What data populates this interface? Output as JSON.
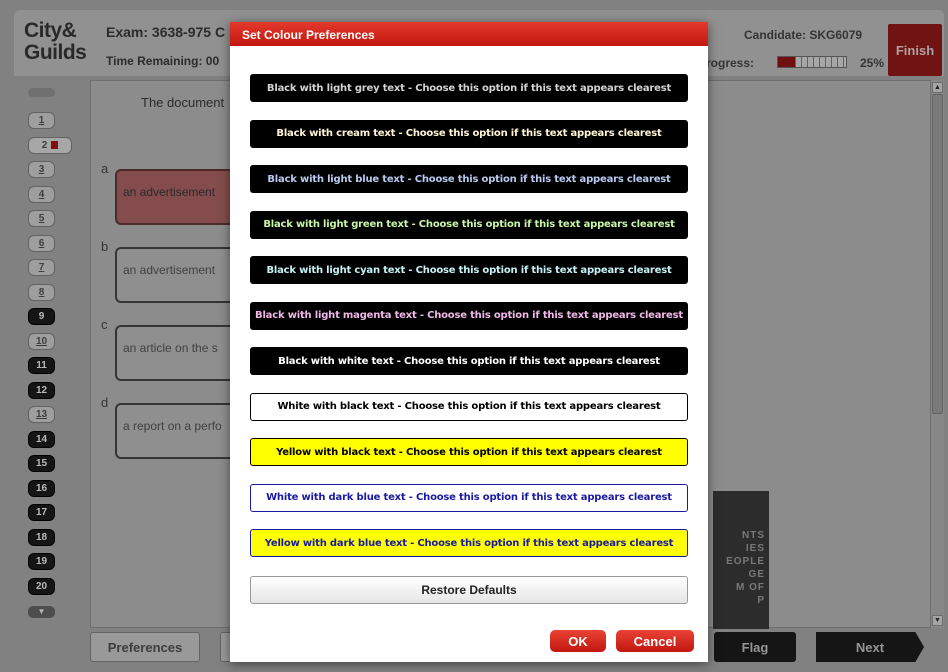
{
  "header": {
    "logo_line1": "City&",
    "logo_line2": "Guilds",
    "exam_title": "Exam: 3638-975 C",
    "time_remaining": "Time Remaining: 00",
    "candidate": "Candidate: SKG6079",
    "progress_label": "rogress:",
    "progress_percent": "25%",
    "progress_value": 0.25,
    "finish_label": "Finish"
  },
  "sidebar": {
    "questions": [
      {
        "num": "1",
        "state": "answered"
      },
      {
        "num": "2",
        "state": "flagged"
      },
      {
        "num": "3",
        "state": "answered"
      },
      {
        "num": "4",
        "state": "answered"
      },
      {
        "num": "5",
        "state": "answered"
      },
      {
        "num": "6",
        "state": "answered"
      },
      {
        "num": "7",
        "state": "answered"
      },
      {
        "num": "8",
        "state": "answered"
      },
      {
        "num": "9",
        "state": "dark"
      },
      {
        "num": "10",
        "state": "answered"
      },
      {
        "num": "11",
        "state": "dark"
      },
      {
        "num": "12",
        "state": "dark"
      },
      {
        "num": "13",
        "state": "answered"
      },
      {
        "num": "14",
        "state": "dark"
      },
      {
        "num": "15",
        "state": "dark"
      },
      {
        "num": "16",
        "state": "dark"
      },
      {
        "num": "17",
        "state": "dark"
      },
      {
        "num": "18",
        "state": "dark"
      },
      {
        "num": "19",
        "state": "dark"
      },
      {
        "num": "20",
        "state": "dark"
      }
    ]
  },
  "question": {
    "stem": "The document",
    "options": [
      {
        "letter": "a",
        "text": "an advertisement"
      },
      {
        "letter": "b",
        "text": "an advertisement"
      },
      {
        "letter": "c",
        "text": "an article on the s"
      },
      {
        "letter": "d",
        "text": "a report on a perfo"
      }
    ],
    "image_text": "NTS\nIES\nEOPLE\nGE\nM OF\nP"
  },
  "footer": {
    "preferences": "Preferences",
    "flag": "Flag",
    "next": "Next"
  },
  "dialog": {
    "title": "Set Colour Preferences",
    "options": [
      {
        "label": "Black with light grey text - Choose this option if this text appears clearest",
        "bg": "#000000",
        "fg": "#d3d3d3",
        "border": "#000000"
      },
      {
        "label": "Black with cream text - Choose this option if this text appears clearest",
        "bg": "#000000",
        "fg": "#fff5d6",
        "border": "#000000"
      },
      {
        "label": "Black with light blue text - Choose this option if this text appears clearest",
        "bg": "#000000",
        "fg": "#b9c9f0",
        "border": "#000000"
      },
      {
        "label": "Black with light green text - Choose this option if this text appears clearest",
        "bg": "#000000",
        "fg": "#c8f5a6",
        "border": "#000000"
      },
      {
        "label": "Black with light cyan text - Choose this option if this text appears clearest",
        "bg": "#000000",
        "fg": "#c6f2f6",
        "border": "#000000"
      },
      {
        "label": "Black with light magenta text - Choose this option if this text appears clearest",
        "bg": "#000000",
        "fg": "#f0b8e8",
        "border": "#000000"
      },
      {
        "label": "Black with white text - Choose this option if this text appears clearest",
        "bg": "#000000",
        "fg": "#ffffff",
        "border": "#000000"
      },
      {
        "label": "White with black text - Choose this option if this text appears clearest",
        "bg": "#ffffff",
        "fg": "#000000",
        "border": "#000000"
      },
      {
        "label": "Yellow with black text - Choose this option if this text appears clearest",
        "bg": "#ffff00",
        "fg": "#000000",
        "border": "#000000"
      },
      {
        "label": "White with dark blue text - Choose this option if this text appears clearest",
        "bg": "#ffffff",
        "fg": "#1a1aa0",
        "border": "#1a1aa0"
      },
      {
        "label": "Yellow with dark blue text - Choose this option if this text appears clearest",
        "bg": "#ffff00",
        "fg": "#1a1aa0",
        "border": "#1a1aa0"
      }
    ],
    "restore_label": "Restore Defaults",
    "ok_label": "OK",
    "cancel_label": "Cancel"
  }
}
